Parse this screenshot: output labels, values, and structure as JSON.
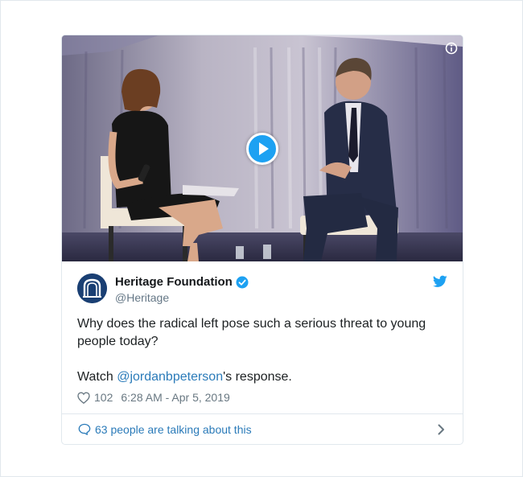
{
  "tweet": {
    "author": {
      "display_name": "Heritage Foundation",
      "handle": "@Heritage",
      "verified": true
    },
    "text_line1": "Why does the radical left pose such a serious threat to young people today?",
    "text_watch_prefix": "Watch ",
    "text_mention": "@jordanbpeterson",
    "text_watch_suffix": "'s response.",
    "like_count": "102",
    "timestamp": "6:28 AM - Apr 5, 2019",
    "footer_text": "63 people are talking about this"
  },
  "colors": {
    "twitter_blue": "#1da1f2",
    "link_blue": "#2b7bb9",
    "text_primary": "#1c2022",
    "text_secondary": "#697882",
    "border": "#e1e8ed",
    "avatar_bg": "#1a3f73"
  },
  "icons": {
    "media_play": "play-icon",
    "media_info": "info-icon",
    "verified": "verified-badge-icon",
    "brand": "twitter-bird-icon",
    "like": "heart-icon",
    "footer": "speech-bubble-icon",
    "footer_chevron": "chevron-right-icon"
  }
}
